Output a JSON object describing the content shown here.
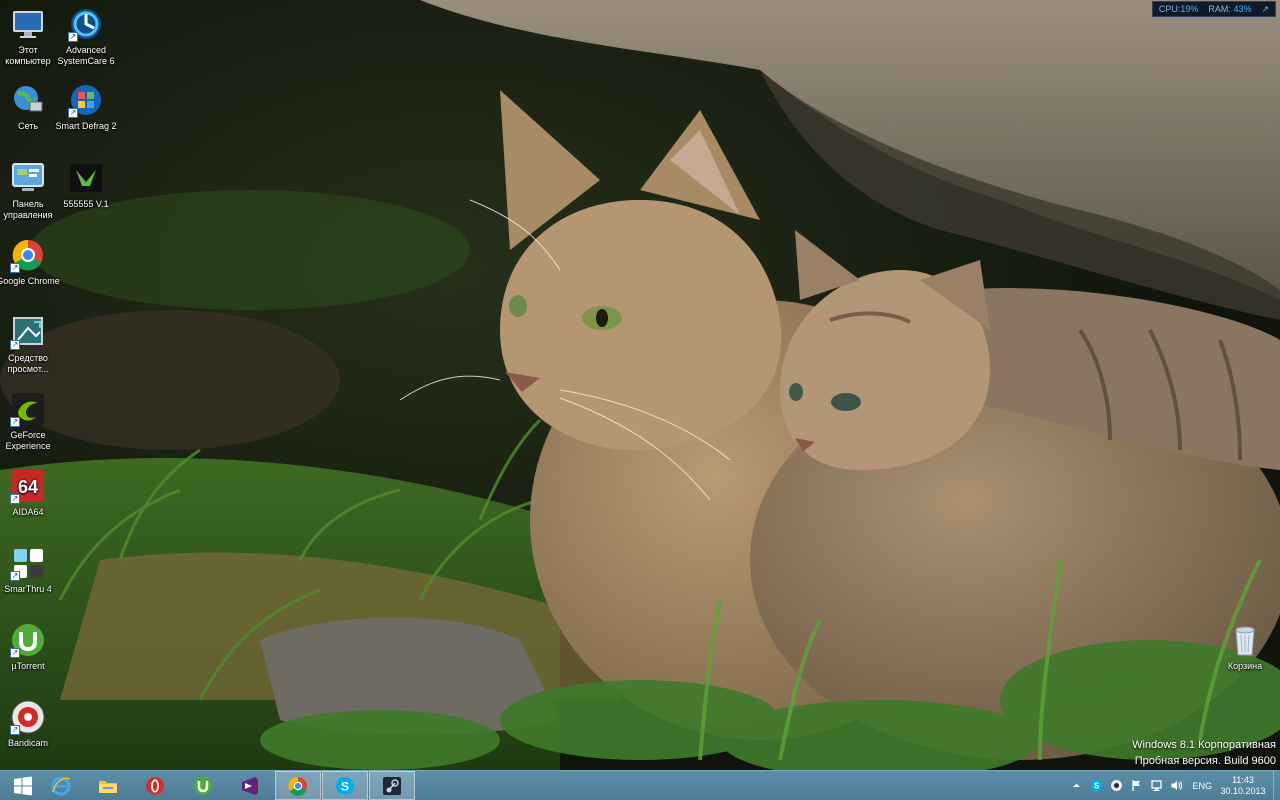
{
  "desktop": {
    "icons_left": [
      {
        "label": "Этот компьютер",
        "icon": "computer-icon"
      },
      {
        "label": "Advanced SystemCare 6",
        "icon": "advanced-systemcare-icon"
      },
      {
        "label": "Сеть",
        "icon": "network-icon"
      },
      {
        "label": "Smart Defrag 2",
        "icon": "smart-defrag-icon"
      },
      {
        "label": "Панель управления",
        "icon": "control-panel-icon"
      },
      {
        "label": "555555 V.1",
        "icon": "geeks3d-icon"
      },
      {
        "label": "Google Chrome",
        "icon": "chrome-icon"
      },
      {
        "label": "Средство просмот...",
        "icon": "viewer-icon"
      },
      {
        "label": "GeForce Experience",
        "icon": "geforce-icon"
      },
      {
        "label": "AIDA64",
        "icon": "aida64-icon"
      },
      {
        "label": "SmarThru 4",
        "icon": "smarthru-icon"
      },
      {
        "label": "µTorrent",
        "icon": "utorrent-icon"
      },
      {
        "label": "Bandicam",
        "icon": "bandicam-icon"
      }
    ],
    "recycle_bin": {
      "label": "Корзина",
      "icon": "recycle-bin-icon"
    }
  },
  "monitor": {
    "cpu_label": "CPU:",
    "cpu_value": "19%",
    "ram_label": "RAM:",
    "ram_value": "43%"
  },
  "watermark": {
    "line1": "Windows 8.1 Корпоративная",
    "line2": "Пробная версия. Build 9600"
  },
  "taskbar": {
    "pinned": [
      {
        "name": "start-button",
        "icon": "windows-logo-icon"
      },
      {
        "name": "internet-explorer",
        "icon": "ie-icon"
      },
      {
        "name": "file-explorer",
        "icon": "folder-icon"
      },
      {
        "name": "opera",
        "icon": "opera-icon"
      },
      {
        "name": "utorrent",
        "icon": "utorrent-icon"
      },
      {
        "name": "visual-studio",
        "icon": "visual-studio-icon"
      },
      {
        "name": "google-chrome",
        "icon": "chrome-icon"
      },
      {
        "name": "skype",
        "icon": "skype-icon"
      },
      {
        "name": "steam",
        "icon": "steam-icon"
      }
    ],
    "language": "ENG",
    "time": "11:43",
    "date": "30.10.2013"
  },
  "colors": {
    "taskbar": "#5588a3",
    "accent": "#3fb6ff"
  }
}
